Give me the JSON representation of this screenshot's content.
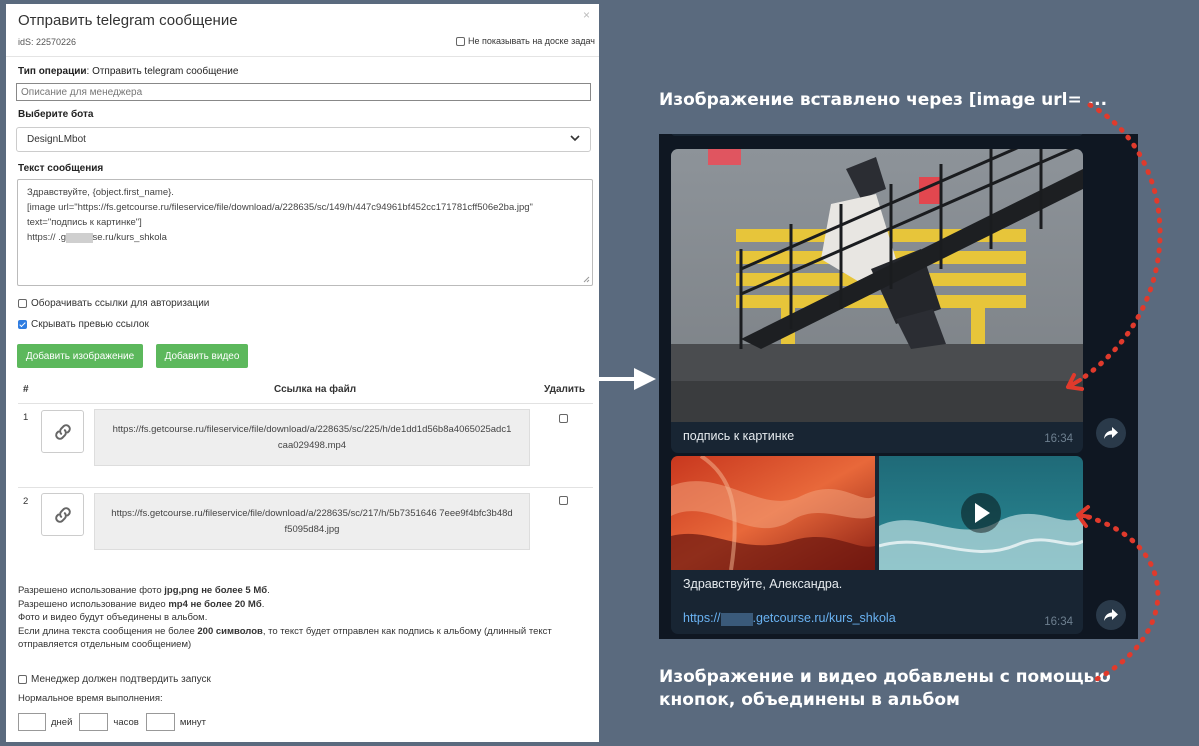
{
  "modal": {
    "title": "Отправить telegram сообщение",
    "close": "×",
    "ids": "idS: 22570226",
    "hide_label": "Не показывать на доске задач",
    "op_label": "Тип операции",
    "op_value": ": Отправить telegram сообщение",
    "desc_placeholder": "Описание для менеджера",
    "bot_label": "Выберите бота",
    "bot_value": "DesignLMbot",
    "text_label": "Текст сообщения",
    "text_lines": [
      "Здравствуйте, {object.first_name}.",
      "[image url=\"https://fs.getcourse.ru/fileservice/file/download/a/228635/sc/149/h/447c94961bf452cc171781cff506e2ba.jpg\"",
      "text=\"подпись к картинке\"]",
      "https://       .getcourse.ru/kurs_shkola"
    ],
    "wrap_links": "Оборачивать ссылки для авторизации",
    "hide_preview": "Скрывать превью ссылок",
    "add_image": "Добавить изображение",
    "add_video": "Добавить видео",
    "table": {
      "col_num": "#",
      "col_link": "Ссылка на файл",
      "col_delete": "Удалить",
      "rows": [
        {
          "num": "1",
          "url1": "https://fs.getcourse.ru/fileservice/file/download/a/228635/sc/225/h/de1dd1d56b8a4065025adc1",
          "url2": "caa029498.mp4"
        },
        {
          "num": "2",
          "url1": "https://fs.getcourse.ru/fileservice/file/download/a/228635/sc/217/h/5b7351646 7eee9f4bfc3b48d",
          "url2": "f5095d84.jpg"
        }
      ]
    },
    "notes": {
      "l1a": "Разрешено использование фото ",
      "l1b": "jpg,png не более 5 Мб",
      "l1c": ".",
      "l2a": "Разрешено использование видео ",
      "l2b": "mp4 не более 20 Мб",
      "l2c": ".",
      "l3": "Фото и видео будут объединены в альбом.",
      "l4a": "Если длина текста сообщения не более ",
      "l4b": "200 символов",
      "l4c": ", то текст будет отправлен как подпись к альбому (длинный текст",
      "l5": "отправляется отдельным сообщением)"
    },
    "confirm": "Менеджер должен подтвердить запуск",
    "normal_time": "Нормальное время выполнения:",
    "days": "дней",
    "hours": "часов",
    "minutes": "минут"
  },
  "telegram": {
    "caption": "подпись к картинке",
    "time1": "16:34",
    "greeting": "Здравствуйте, Александра.",
    "link_a": "https://",
    "link_b": ".getcourse.ru/kurs_shkola",
    "time2": "16:34"
  },
  "annotations": {
    "top": "Изображение вставлено через [image url= ...",
    "bottom1": "Изображение и видео добавлены с помощью",
    "bottom2": "кнопок, объединены в альбом"
  },
  "colors": {
    "green": "#5cb85c",
    "accent_red": "#e03a2c",
    "tg_bubble": "#182533",
    "tg_link": "#6ab3f3"
  }
}
